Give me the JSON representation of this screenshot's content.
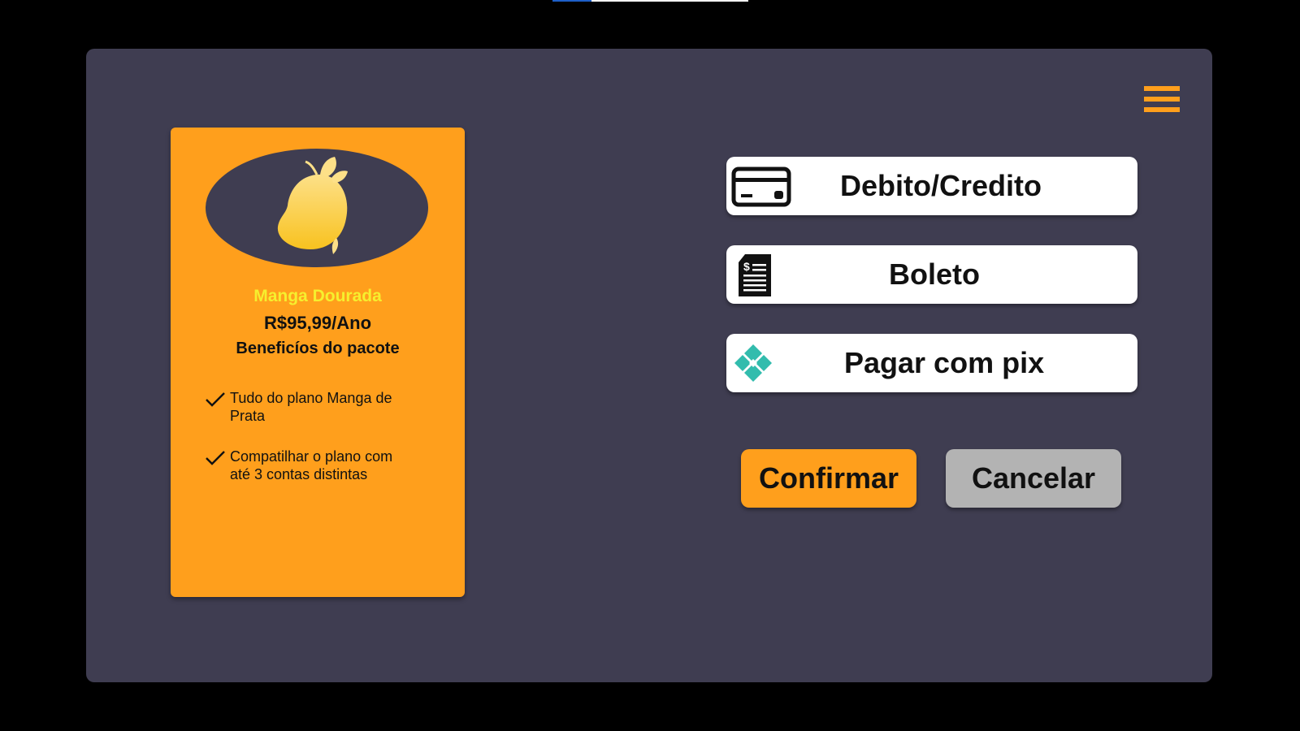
{
  "menu": {
    "icon": "hamburger-menu-icon"
  },
  "plan": {
    "name": "Manga Dourada",
    "price": "R$95,99/Ano",
    "benefits_title": "Beneficíos do pacote",
    "benefits": [
      "Tudo do plano Manga de Prata",
      "Compatilhar o plano com até 3 contas distintas"
    ],
    "logo_icon": "mango-icon"
  },
  "payment_options": [
    {
      "label": "Debito/Credito",
      "icon": "credit-card-icon"
    },
    {
      "label": "Boleto",
      "icon": "boleto-document-icon"
    },
    {
      "label": "Pagar com pix",
      "icon": "pix-icon"
    }
  ],
  "actions": {
    "confirm": "Confirmar",
    "cancel": "Cancelar"
  },
  "colors": {
    "background": "#000000",
    "panel": "#3f3d51",
    "accent": "#ff9f1c",
    "plan_name": "#f6ef2e",
    "cancel": "#b3b3b3",
    "pix": "#32bcad"
  }
}
